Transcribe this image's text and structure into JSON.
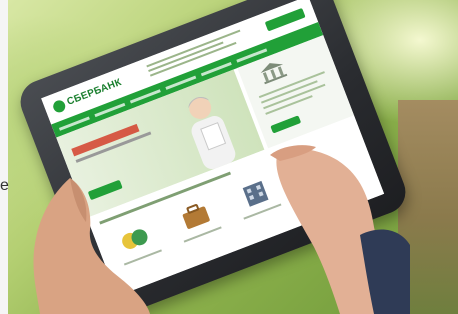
{
  "scene": {
    "alt_char": "e",
    "site_logo": "СБЕРБАНК"
  },
  "colors": {
    "brand_green": "#21a038",
    "accent_red": "#d33f2c",
    "background_green": "#8db14c"
  }
}
